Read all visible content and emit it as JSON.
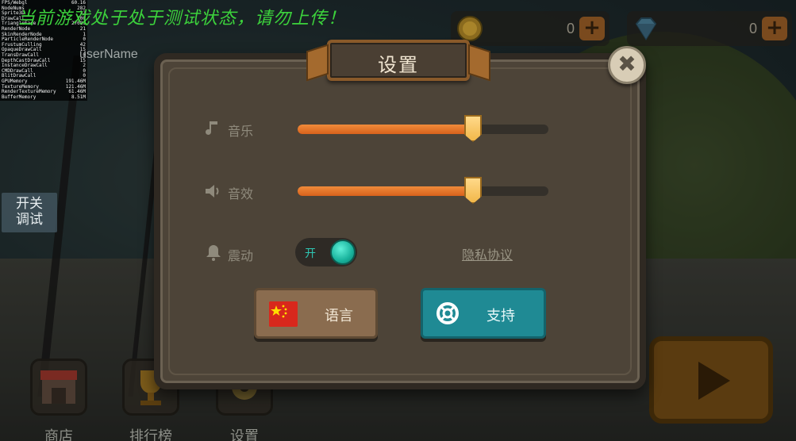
{
  "test_banner": "当前游戏处于处于测试状态，请勿上传！",
  "user_name": "userName",
  "debug_toggle": {
    "line1": "开关",
    "line2": "调试"
  },
  "debug_stats": [
    {
      "label": "FPS/Webgl",
      "value": "60.16"
    },
    {
      "label": "NodeNums",
      "value": "282"
    },
    {
      "label": "Sprite3D",
      "value": "32"
    },
    {
      "label": "DrawCall",
      "value": "100"
    },
    {
      "label": "TriangleFace",
      "value": "27089"
    },
    {
      "label": "RenderNode",
      "value": "21"
    },
    {
      "label": "SkinRenderNode",
      "value": "1"
    },
    {
      "label": "ParticleRenderNode",
      "value": "0"
    },
    {
      "label": "FrustumCulling",
      "value": "42"
    },
    {
      "label": "OpaqueDrawCall",
      "value": "15"
    },
    {
      "label": "TransDrawCall",
      "value": "0"
    },
    {
      "label": "DepthCastDrawCall",
      "value": "15"
    },
    {
      "label": "InstanceDrawCall",
      "value": "2"
    },
    {
      "label": "CMDDrawCall",
      "value": "0"
    },
    {
      "label": "BlitDrawCall",
      "value": "0"
    },
    {
      "label": "GPUMemory",
      "value": "191.46M"
    },
    {
      "label": "TextureMemory",
      "value": "121.46M"
    },
    {
      "label": "RenderTextureMemory",
      "value": "61.46M"
    },
    {
      "label": "BufferMemory",
      "value": "8.51M"
    }
  ],
  "currency": {
    "coins": "0",
    "gems": "0",
    "plus": "+"
  },
  "bottom_nav": {
    "shop": "商店",
    "leaderboard": "排行榜",
    "settings": "设置"
  },
  "dialog": {
    "title": "设置",
    "close": "✖",
    "music_label": "音乐",
    "music_level": 0.7,
    "sfx_label": "音效",
    "sfx_level": 0.7,
    "vibration_label": "震动",
    "vibration_state": "开",
    "privacy_link": "隐私协议",
    "language_button": "语言",
    "support_button": "支持"
  },
  "colors": {
    "slider_fill": "#e8742a",
    "toggle_on": "#1fbfa8",
    "support_btn": "#1f8a94",
    "language_btn": "#8a6c4f",
    "test_banner": "#3cd23c"
  }
}
